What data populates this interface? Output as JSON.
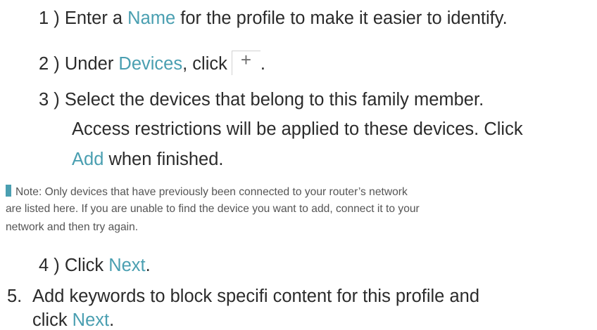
{
  "steps": [
    {
      "num": "1 )",
      "pre": "Enter a ",
      "hl": "Name",
      "post": " for the profile to make it easier to identify."
    },
    {
      "num": "2 )",
      "pre": "Under ",
      "hl": "Devices",
      "post": ", click",
      "icon": "plus-icon",
      "glyph": "+",
      "end": "."
    },
    {
      "num": "3 )",
      "line1": "Select the devices that belong to this family member.",
      "line2": "Access restrictions will be applied to these devices. Click",
      "hl": "Add",
      "post": " when finished."
    },
    {
      "num": "4 )",
      "pre": "Click ",
      "hl": "Next",
      "post": "."
    }
  ],
  "note": {
    "line1": "Note: Only devices that have previously been connected to your router’s network",
    "line2": "are listed here. If you are unable to find the device you want to add, connect it to your",
    "line3": "network and then try again."
  },
  "step5": {
    "num": "5.",
    "line1": "Add keywords to block specifi content for this profile and",
    "pre": "click ",
    "hl": "Next",
    "post": "."
  },
  "colors": {
    "highlight": "#4a9fb1",
    "text": "#2b2b2b"
  }
}
